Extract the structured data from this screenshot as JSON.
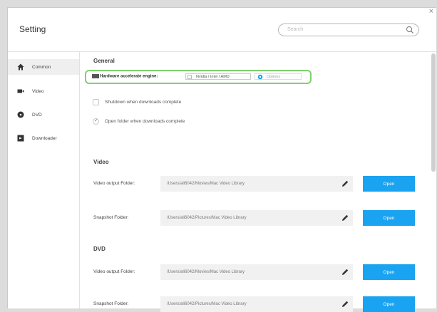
{
  "window": {
    "title": "Setting",
    "close_glyph": "×"
  },
  "search": {
    "placeholder": "Search",
    "icon": "search-icon"
  },
  "sidebar": {
    "items": [
      {
        "label": "Common",
        "icon": "home-icon",
        "selected": true
      },
      {
        "label": "Video",
        "icon": "video-camera-icon",
        "selected": false
      },
      {
        "label": "DVD",
        "icon": "disc-icon",
        "selected": false
      },
      {
        "label": "Downloader",
        "icon": "download-icon",
        "selected": false
      }
    ]
  },
  "general": {
    "title": "General",
    "hw_label": "Hardware accelerate engine:",
    "hw_option": "Nvidia / Intel / AMD",
    "options_label": "Options",
    "shutdown_label": "Shutdown when downloads complete",
    "shutdown_checked": false,
    "open_folder_label": "Open folder when downloads complete",
    "open_folder_checked": true
  },
  "video": {
    "title": "Video",
    "rows": [
      {
        "label": "Video output Folder:",
        "path": "/Users/ali6042/Movies/Mac Video Library",
        "button": "Open"
      },
      {
        "label": "Snapshot Folder:",
        "path": "/Users/ali6042/Pictures/Mac Video Library",
        "button": "Open"
      }
    ]
  },
  "dvd": {
    "title": "DVD",
    "rows": [
      {
        "label": "Video output Folder:",
        "path": "/Users/ali6042/Movies/Mac Video Library",
        "button": "Open"
      },
      {
        "label": "Snapshot Folder:",
        "path": "/Users/ali6042/Pictures/Mac Video Library",
        "button": "Open"
      }
    ]
  },
  "colors": {
    "accent": "#1aa3f0",
    "highlight": "#7bd36b"
  }
}
